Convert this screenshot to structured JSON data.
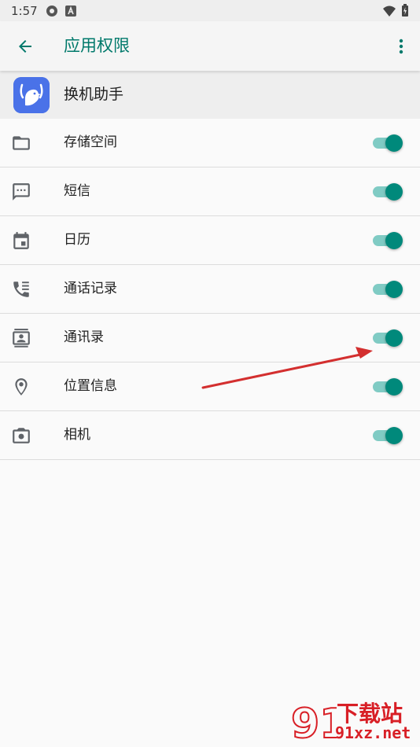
{
  "status_bar": {
    "time": "1:57"
  },
  "app_bar": {
    "title": "应用权限"
  },
  "app_header": {
    "name": "换机助手"
  },
  "permissions": [
    {
      "label": "存储空间",
      "icon": "folder-icon",
      "enabled": true
    },
    {
      "label": "短信",
      "icon": "sms-icon",
      "enabled": true
    },
    {
      "label": "日历",
      "icon": "calendar-icon",
      "enabled": true
    },
    {
      "label": "通话记录",
      "icon": "call-log-icon",
      "enabled": true
    },
    {
      "label": "通讯录",
      "icon": "contacts-icon",
      "enabled": true
    },
    {
      "label": "位置信息",
      "icon": "location-icon",
      "enabled": true
    },
    {
      "label": "相机",
      "icon": "camera-icon",
      "enabled": true
    }
  ],
  "colors": {
    "accent": "#00796b",
    "switch_thumb": "#00897b",
    "switch_track": "#80cbc4",
    "annotation_arrow": "#d32f2f"
  },
  "watermark": {
    "top": "下载站",
    "bottom": "91xz.net"
  }
}
